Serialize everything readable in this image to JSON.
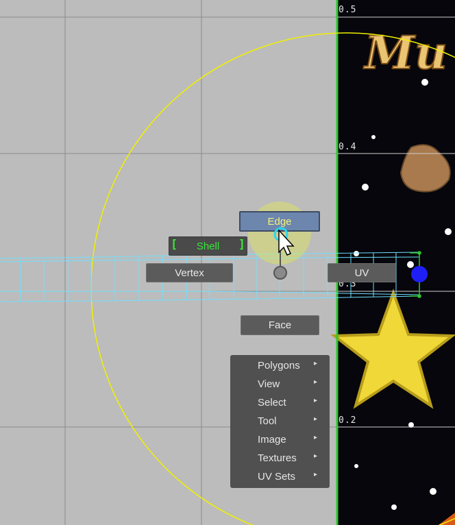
{
  "tick_labels": [
    "0.5",
    "0.4",
    "0.3",
    "0.2"
  ],
  "marking_menu": {
    "edge": "Edge",
    "shell": "Shell",
    "vertex": "Vertex",
    "uv": "UV",
    "face": "Face"
  },
  "menu_items": [
    {
      "label": "Polygons",
      "arrow": "▸"
    },
    {
      "label": "View",
      "arrow": "▸"
    },
    {
      "label": "Select",
      "arrow": "▸"
    },
    {
      "label": "Tool",
      "arrow": "▸"
    },
    {
      "label": "Image",
      "arrow": "▸"
    },
    {
      "label": "Textures",
      "arrow": "▸"
    },
    {
      "label": "UV Sets",
      "arrow": "▸"
    }
  ],
  "texture_text": "Mu",
  "colors": {
    "grid_bg": "#bcbcbc",
    "uv_border": "#2ec82e",
    "wireframe": "#6fe0ff",
    "circle": "#f0f000",
    "highlight": "#eef33a",
    "handle": "#1f1ff5"
  },
  "icons": {
    "cursor": "arrow-pointer-icon",
    "pivot": "circle-handle-icon",
    "scale": "blue-dot-handle-icon"
  }
}
